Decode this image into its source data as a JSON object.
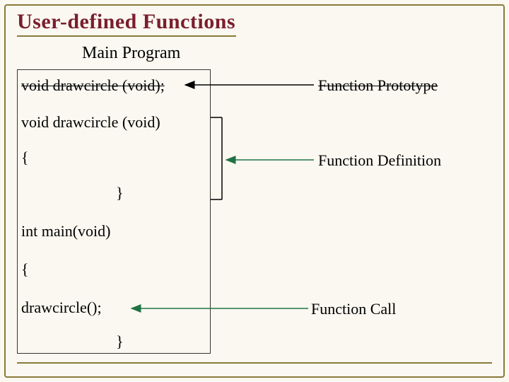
{
  "title": "User-defined Functions",
  "subtitle": "Main Program",
  "code": {
    "line1": "void drawcircle (void);",
    "line2": "void drawcircle (void)",
    "line3": "{",
    "line4": "}",
    "line5": "int main(void)",
    "line6": "{",
    "line7": "drawcircle();",
    "line8": "}"
  },
  "labels": {
    "prototype": "Function Prototype",
    "definition": "Function Definition",
    "call": "Function Call"
  },
  "colors": {
    "accent": "#8a7a3a",
    "title": "#7a1e2e",
    "arrow_def": "#207245",
    "arrow_call": "#207245",
    "arrow_proto": "#000000",
    "bg": "#faf8f0"
  }
}
